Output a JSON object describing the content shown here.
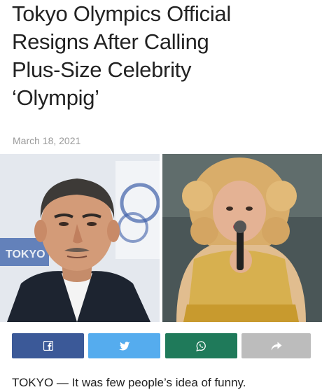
{
  "article": {
    "headline_lines": [
      "Tokyo Olympics Official",
      "Resigns After Calling",
      "Plus-Size Celebrity",
      "‘Olympig’"
    ],
    "date": "March 18, 2021",
    "lead_text": "TOKYO — It was few people’s idea of funny."
  },
  "photos": {
    "left_background_text": "TOKYO"
  },
  "share_bar": {
    "buttons": [
      {
        "network": "facebook",
        "icon": "facebook-icon",
        "color": "#3b5998"
      },
      {
        "network": "twitter",
        "icon": "twitter-icon",
        "color": "#55acee"
      },
      {
        "network": "whatsapp",
        "icon": "whatsapp-icon",
        "color": "#1f7a5a"
      },
      {
        "network": "share",
        "icon": "share-arrow-icon",
        "color": "#bcbcbc"
      }
    ]
  }
}
